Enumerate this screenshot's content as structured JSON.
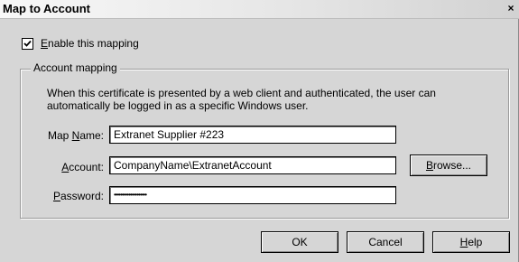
{
  "window": {
    "title": "Map to Account",
    "close_glyph": "×"
  },
  "enable_mapping": {
    "checked": true,
    "label_prefix": "",
    "label_mnemonic": "E",
    "label_rest": "nable this mapping"
  },
  "account_mapping": {
    "legend": "Account mapping",
    "description": "When this certificate is presented by a web client and authenticated, the user can automatically be logged in as a specific Windows user.",
    "map_name": {
      "label_prefix": "Map ",
      "label_mnemonic": "N",
      "label_rest": "ame:",
      "value": "Extranet Supplier #223"
    },
    "account": {
      "label_prefix": "",
      "label_mnemonic": "A",
      "label_rest": "ccount:",
      "value": "CompanyName\\ExtranetAccount",
      "browse_mnemonic": "B",
      "browse_rest": "rowse..."
    },
    "password": {
      "label_prefix": "",
      "label_mnemonic": "P",
      "label_rest": "assword:",
      "value": "••••••••••••••••••••"
    }
  },
  "buttons": {
    "ok": "OK",
    "cancel": "Cancel",
    "help_mnemonic": "H",
    "help_rest": "elp"
  },
  "colors": {
    "dialog_bg": "#d6d6d6",
    "field_bg": "#ffffff"
  }
}
